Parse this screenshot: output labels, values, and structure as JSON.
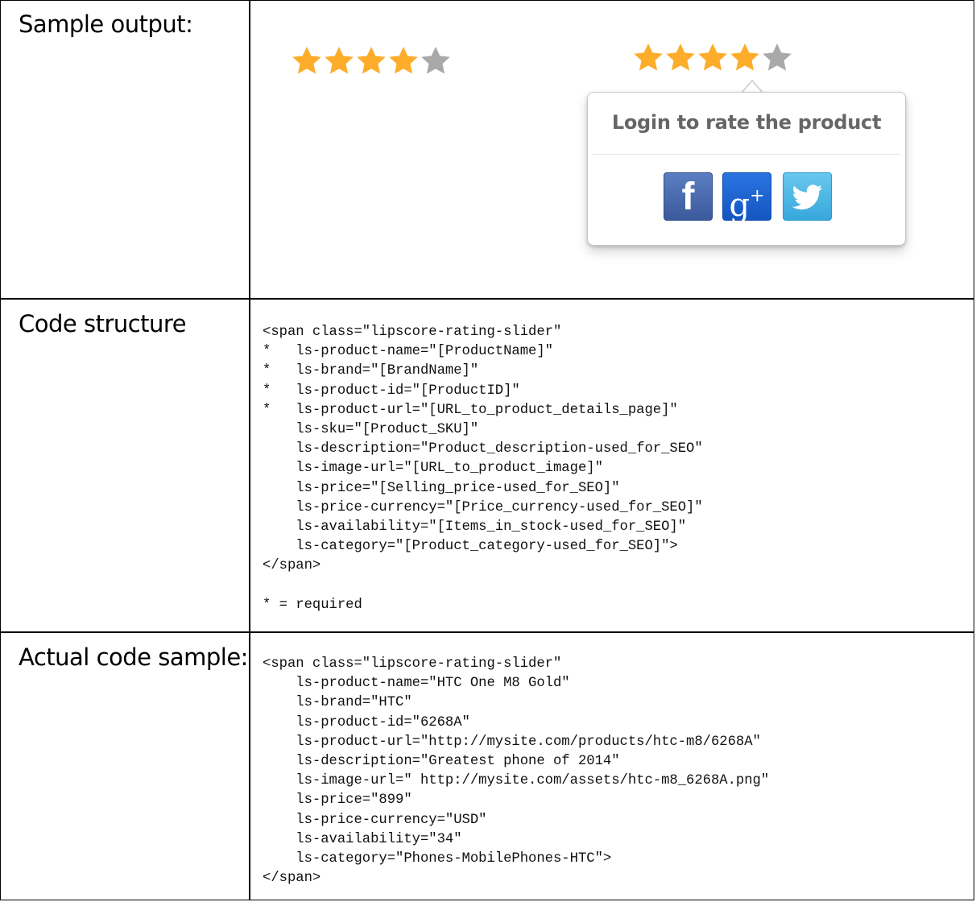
{
  "rows": {
    "sample_output": {
      "label": "Sample output:",
      "rating_display": {
        "stars_filled": 4,
        "stars_total": 5
      },
      "rating_with_popup": {
        "stars_filled": 4,
        "stars_total": 5,
        "popup_title": "Login to rate the product",
        "social_buttons": [
          {
            "name": "facebook",
            "glyph": "f",
            "color": "#3b5a9c"
          },
          {
            "name": "google-plus",
            "glyph": "g+",
            "color": "#1356c2"
          },
          {
            "name": "twitter",
            "glyph": "bird",
            "color": "#37a7dc"
          }
        ]
      },
      "colors": {
        "star_filled": "#fdad2a",
        "star_empty": "#a9a9a9"
      }
    },
    "code_structure": {
      "label": "Code structure",
      "lines": [
        "<span class=\"lipscore-rating-slider\"",
        "*   ls-product-name=\"[ProductName]\"",
        "*   ls-brand=\"[BrandName]\"",
        "*   ls-product-id=\"[ProductID]\"",
        "*   ls-product-url=\"[URL_to_product_details_page]\"",
        "    ls-sku=\"[Product_SKU]\"",
        "    ls-description=\"Product_description-used_for_SEO\"",
        "    ls-image-url=\"[URL_to_product_image]\"",
        "    ls-price=\"[Selling_price-used_for_SEO]\"",
        "    ls-price-currency=\"[Price_currency-used_for_SEO]\"",
        "    ls-availability=\"[Items_in_stock-used_for_SEO]\"",
        "    ls-category=\"[Product_category-used_for_SEO]\">",
        "</span>",
        "",
        "* = required"
      ]
    },
    "actual_code_sample": {
      "label": "Actual code sample:",
      "lines": [
        "<span class=\"lipscore-rating-slider\"",
        "    ls-product-name=\"HTC One M8 Gold\"",
        "    ls-brand=\"HTC\"",
        "    ls-product-id=\"6268A\"",
        "    ls-product-url=\"http://mysite.com/products/htc-m8/6268A\"",
        "    ls-description=\"Greatest phone of 2014\"",
        "    ls-image-url=\" http://mysite.com/assets/htc-m8_6268A.png\"",
        "    ls-price=\"899\"",
        "    ls-price-currency=\"USD\"",
        "    ls-availability=\"34\"",
        "    ls-category=\"Phones-MobilePhones-HTC\">",
        "</span>"
      ]
    }
  }
}
